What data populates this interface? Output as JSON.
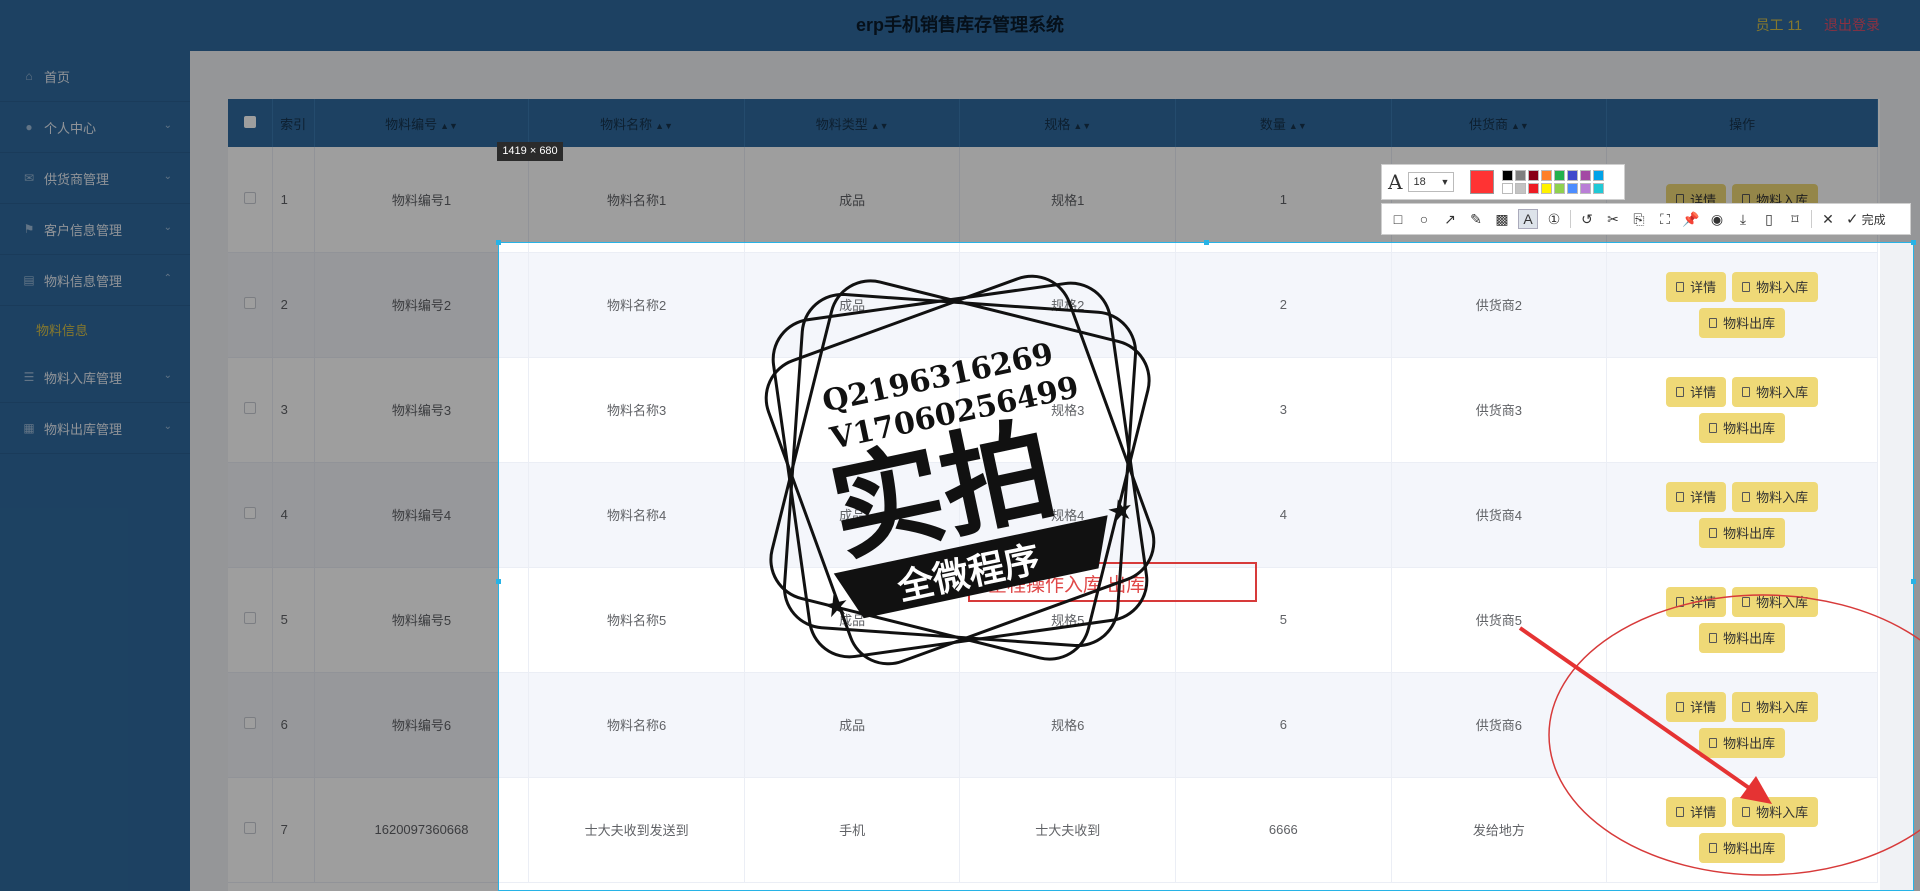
{
  "header": {
    "title": "erp手机销售库存管理系统",
    "user": "员工 11",
    "logout": "退出登录"
  },
  "sidebar": {
    "items": [
      {
        "label": "首页",
        "icon": "home-icon"
      },
      {
        "label": "个人中心",
        "icon": "user-icon"
      },
      {
        "label": "供货商管理",
        "icon": "mail-icon"
      },
      {
        "label": "客户信息管理",
        "icon": "flag-icon"
      },
      {
        "label": "物料信息管理",
        "icon": "folder-icon"
      },
      {
        "label": "物料入库管理",
        "icon": "list-icon"
      },
      {
        "label": "物料出库管理",
        "icon": "calendar-icon"
      }
    ],
    "submenu": {
      "label": "物料信息"
    }
  },
  "table": {
    "columns": [
      "索引",
      "物料编号",
      "物料名称",
      "物料类型",
      "规格",
      "数量",
      "供货商",
      "操作"
    ],
    "rows": [
      {
        "idx": "1",
        "code": "物料编号1",
        "name": "物料名称1",
        "type": "成品",
        "spec": "规格1",
        "qty": "1",
        "supplier": ""
      },
      {
        "idx": "2",
        "code": "物料编号2",
        "name": "物料名称2",
        "type": "成品",
        "spec": "规格2",
        "qty": "2",
        "supplier": "供货商2"
      },
      {
        "idx": "3",
        "code": "物料编号3",
        "name": "物料名称3",
        "type": "",
        "spec": "规格3",
        "qty": "3",
        "supplier": "供货商3"
      },
      {
        "idx": "4",
        "code": "物料编号4",
        "name": "物料名称4",
        "type": "成品",
        "spec": "规格4",
        "qty": "4",
        "supplier": "供货商4"
      },
      {
        "idx": "5",
        "code": "物料编号5",
        "name": "物料名称5",
        "type": "成品",
        "spec": "规格5",
        "qty": "5",
        "supplier": "供货商5"
      },
      {
        "idx": "6",
        "code": "物料编号6",
        "name": "物料名称6",
        "type": "成品",
        "spec": "规格6",
        "qty": "6",
        "supplier": "供货商6"
      },
      {
        "idx": "7",
        "code": "1620097360668",
        "name": "士大夫收到发送到",
        "type": "手机",
        "spec": "士大夫收到",
        "qty": "6666",
        "supplier": "发给地方"
      }
    ],
    "actions": {
      "detail": "详情",
      "stock_in": "物料入库",
      "stock_out": "物料出库"
    }
  },
  "capture": {
    "size": "1419 × 680"
  },
  "toolbar": {
    "font_size": "18",
    "current_color": "#ff3333",
    "palette": [
      "#000000",
      "#7f7f7f",
      "#880015",
      "#ff7f27",
      "#22b14c",
      "#3f48cc",
      "#a349a4",
      "#00a2e8",
      "#ffffff",
      "#c3c3c3",
      "#ed1c24",
      "#fff200",
      "#8fd14f",
      "#4d8dff",
      "#b97fd6",
      "#20c9d6"
    ],
    "done": "完成"
  },
  "annotations": {
    "note": "全程操作入库 出库"
  },
  "stamp": {
    "line1": "Q2196316269",
    "line2": "V17060256499",
    "big": "实拍",
    "banner": "全微程序"
  },
  "colors": {
    "header": "#2f6a9e",
    "button": "#efd977",
    "accent_yellow": "#d8c24a"
  }
}
